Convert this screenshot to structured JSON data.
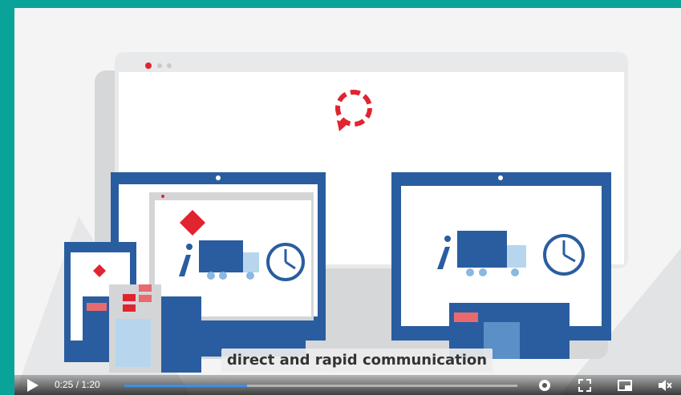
{
  "video": {
    "caption": "direct and rapid communication",
    "time_display": "0:25 / 1:20",
    "progress_fraction": 0.3125
  },
  "colors": {
    "frame": "#0aa39a",
    "accent_red": "#e02430",
    "monitor_blue": "#2a5d9f",
    "progress_blue": "#3d8fe3"
  },
  "icons": [
    "play-icon",
    "settings-icon",
    "fullscreen-icon",
    "miniplayer-icon",
    "volume-icon"
  ]
}
